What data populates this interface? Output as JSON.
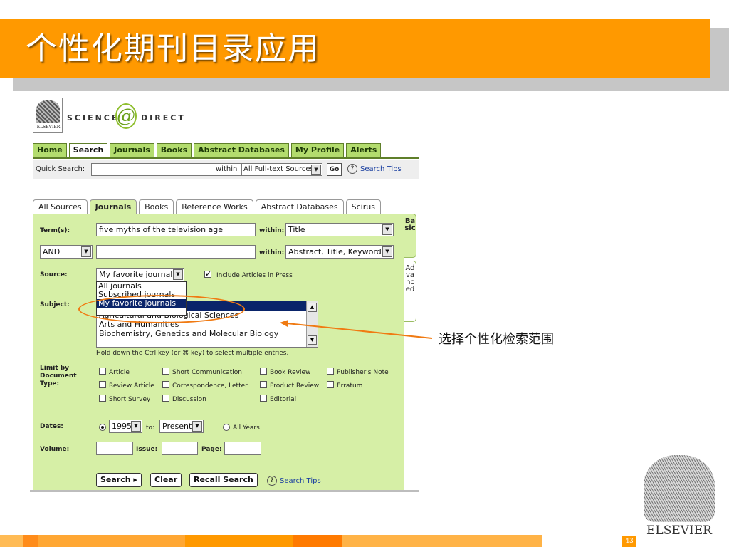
{
  "slide": {
    "title": "个性化期刊目录应用",
    "page_number": "43",
    "callout": "选择个性化检索范围"
  },
  "logo": {
    "publisher_mini": "ELSEVIER",
    "word_left": "SCIENCE",
    "word_right": "DIRECT",
    "at": "@"
  },
  "nav": [
    "Home",
    "Search",
    "Journals",
    "Books",
    "Abstract Databases",
    "My Profile",
    "Alerts"
  ],
  "quick": {
    "label": "Quick Search:",
    "within": "within",
    "scope": "All Full-text Sources",
    "go": "Go",
    "tips": "Search Tips"
  },
  "tabs": [
    "All Sources",
    "Journals",
    "Books",
    "Reference Works",
    "Abstract Databases",
    "Scirus"
  ],
  "side_tabs": {
    "basic": "Basic",
    "advanced": "Advanced"
  },
  "form": {
    "term_label": "Term(s):",
    "term1": "five myths of the television age",
    "within_label": "within:",
    "within1": "Title",
    "operator": "AND",
    "within2": "Abstract, Title, Keywords",
    "source_label": "Source:",
    "source_value": "My favorite journals",
    "include_press": "Include Articles in Press",
    "source_options": [
      "All journals",
      "Subscribed journals",
      "My favorite journals"
    ],
    "subject_label": "Subject:",
    "subject_options": [
      "",
      "Agricultural and Biological Sciences",
      "Arts and Humanities",
      "Biochemistry, Genetics and Molecular Biology"
    ],
    "hint": "Hold down the Ctrl key (or ⌘ key) to select multiple entries.",
    "limit_label": "Limit by Document Type:",
    "doc_types": [
      [
        "Article",
        "Short Communication",
        "Book Review",
        "Publisher's Note"
      ],
      [
        "Review Article",
        "Correspondence, Letter",
        "Product Review",
        "Erratum"
      ],
      [
        "Short Survey",
        "Discussion",
        "Editorial"
      ]
    ],
    "dates_label": "Dates:",
    "date_from": "1995",
    "to": "to:",
    "date_to": "Present",
    "all_years": "All Years",
    "volume_label": "Volume:",
    "issue_label": "Issue:",
    "page_label": "Page:",
    "btn_search": "Search ▸",
    "btn_clear": "Clear",
    "btn_recall": "Recall Search",
    "tips": "Search Tips"
  },
  "elsevier": "ELSEVIER",
  "colors": {
    "title_bar": "#ff9900",
    "panel": "#d6efa6",
    "highlight": "#0a246a",
    "callout": "#f07a12"
  }
}
